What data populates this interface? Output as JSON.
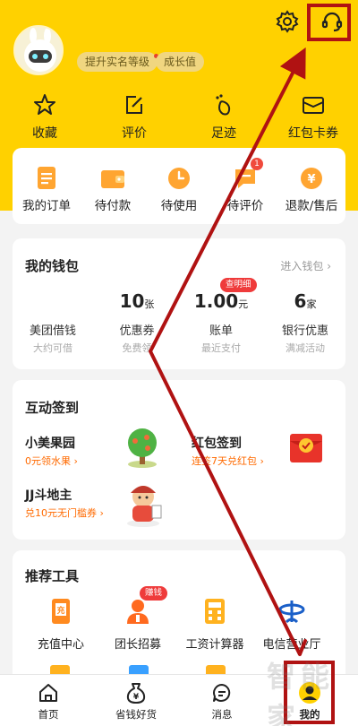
{
  "profile": {
    "badge_realname": "提升实名等级",
    "badge_growth": "成长值"
  },
  "quick_links": [
    {
      "label": "收藏",
      "icon": "star-icon"
    },
    {
      "label": "评价",
      "icon": "edit-icon"
    },
    {
      "label": "足迹",
      "icon": "footprint-icon"
    },
    {
      "label": "红包卡券",
      "icon": "coupon-icon"
    }
  ],
  "orders": {
    "items": [
      {
        "label": "我的订单",
        "icon": "order-list-icon"
      },
      {
        "label": "待付款",
        "icon": "wallet-icon"
      },
      {
        "label": "待使用",
        "icon": "clock-icon"
      },
      {
        "label": "待评价",
        "icon": "comment-icon",
        "badge": "1"
      },
      {
        "label": "退款/售后",
        "icon": "refund-icon"
      }
    ]
  },
  "wallet": {
    "title": "我的钱包",
    "more": "进入钱包",
    "items": [
      {
        "value": "",
        "unit": "",
        "name": "美团借钱",
        "sub": "大约可借"
      },
      {
        "value": "10",
        "unit": "张",
        "name": "优惠券",
        "sub": "免费领"
      },
      {
        "value": "1.00",
        "unit": "元",
        "name": "账单",
        "sub": "最近支付",
        "tag": "查明细"
      },
      {
        "value": "6",
        "unit": "家",
        "name": "银行优惠",
        "sub": "满减活动"
      }
    ]
  },
  "interactive": {
    "title": "互动签到",
    "items": [
      {
        "title": "小美果园",
        "sub": "0元领水果 ›"
      },
      {
        "title": "红包签到",
        "sub": "连签7天兑红包 ›"
      },
      {
        "title": "JJ斗地主",
        "sub": "兑10元无门槛券 ›"
      }
    ]
  },
  "tools": {
    "title": "推荐工具",
    "items": [
      {
        "label": "充值中心",
        "icon": "recharge-icon"
      },
      {
        "label": "团长招募",
        "icon": "leader-icon",
        "tag": "赚钱"
      },
      {
        "label": "工资计算器",
        "icon": "calculator-icon"
      },
      {
        "label": "电信营业厅",
        "icon": "telecom-icon"
      }
    ]
  },
  "tabbar": [
    {
      "label": "首页",
      "icon": "home-icon"
    },
    {
      "label": "省钱好货",
      "icon": "money-bag-icon"
    },
    {
      "label": "消息",
      "icon": "message-icon"
    },
    {
      "label": "我的",
      "icon": "profile-icon"
    }
  ],
  "watermark": "智能家",
  "colors": {
    "brand_yellow": "#ffd100",
    "accent_orange": "#ff6a00",
    "annotation_red": "#b01212"
  }
}
